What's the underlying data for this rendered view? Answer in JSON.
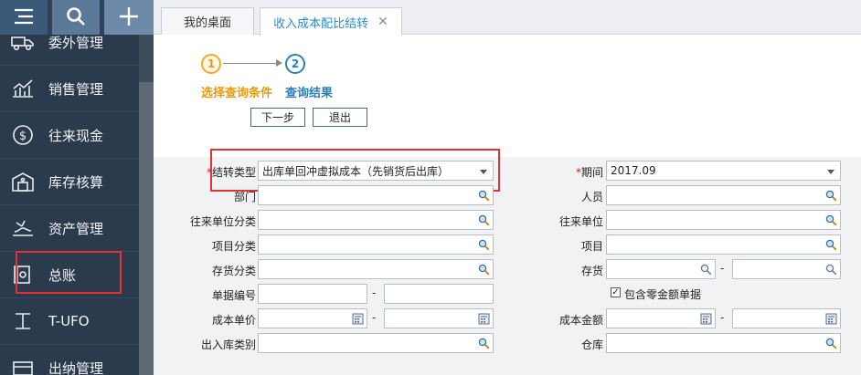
{
  "sidebar": {
    "items": [
      {
        "label": "委外管理",
        "icon": "truck-icon"
      },
      {
        "label": "销售管理",
        "icon": "bar-chart-icon"
      },
      {
        "label": "往来现金",
        "icon": "dollar-circle-icon"
      },
      {
        "label": "库存核算",
        "icon": "warehouse-icon"
      },
      {
        "label": "资产管理",
        "icon": "assets-icon"
      },
      {
        "label": "总账",
        "icon": "ledger-icon"
      },
      {
        "label": "T-UFO",
        "icon": "report-icon"
      },
      {
        "label": "出纳管理",
        "icon": "cashier-icon"
      }
    ]
  },
  "tabs": [
    {
      "label": "我的桌面"
    },
    {
      "label": "收入成本配比结转"
    }
  ],
  "steps": [
    {
      "number": "1",
      "label": "选择查询条件"
    },
    {
      "number": "2",
      "label": "查询结果"
    }
  ],
  "buttons": {
    "next": "下一步",
    "exit": "退出"
  },
  "form": {
    "transfer_type": {
      "label": "结转类型",
      "value": "出库单回冲虚拟成本（先销货后出库）"
    },
    "period": {
      "label": "期间",
      "value": "2017.09"
    },
    "department": {
      "label": "部门"
    },
    "staff": {
      "label": "人员"
    },
    "partner_category": {
      "label": "往来单位分类"
    },
    "partner": {
      "label": "往来单位"
    },
    "project_category": {
      "label": "项目分类"
    },
    "project": {
      "label": "项目"
    },
    "inventory_category": {
      "label": "存货分类"
    },
    "inventory": {
      "label": "存货"
    },
    "doc_number": {
      "label": "单据编号"
    },
    "include_zero": {
      "label": "包含零金额单据",
      "checked": true
    },
    "unit_cost": {
      "label": "成本单价"
    },
    "cost_amount": {
      "label": "成本金额"
    },
    "io_category": {
      "label": "出入库类别"
    },
    "warehouse": {
      "label": "仓库"
    },
    "required_mark": "*",
    "range_dash": "-"
  },
  "colors": {
    "accent_orange": "#e79a10",
    "accent_blue": "#2e7fb8",
    "sidebar_bg": "#2b3a4c",
    "highlight_red": "#e33232"
  }
}
